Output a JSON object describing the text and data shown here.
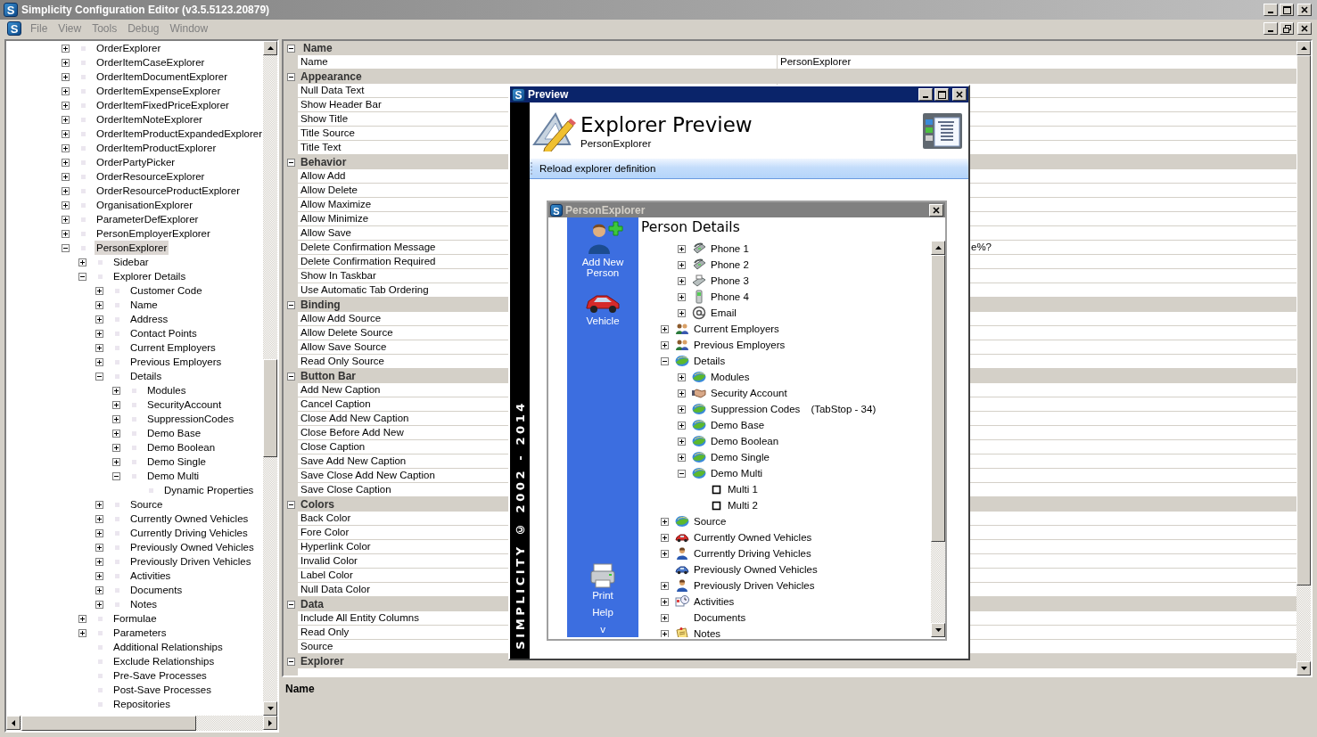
{
  "window": {
    "icon_text": "S",
    "title": "Simplicity Configuration Editor (v3.5.5123.20879)"
  },
  "menu": {
    "icon_text": "S",
    "items": [
      "File",
      "View",
      "Tools",
      "Debug",
      "Window"
    ]
  },
  "left_tree": {
    "items": [
      {
        "label": "OrderExplorer",
        "expanded": false,
        "selected": false
      },
      {
        "label": "OrderItemCaseExplorer",
        "expanded": false,
        "selected": false
      },
      {
        "label": "OrderItemDocumentExplorer",
        "expanded": false,
        "selected": false
      },
      {
        "label": "OrderItemExpenseExplorer",
        "expanded": false,
        "selected": false
      },
      {
        "label": "OrderItemFixedPriceExplorer",
        "expanded": false,
        "selected": false
      },
      {
        "label": "OrderItemNoteExplorer",
        "expanded": false,
        "selected": false
      },
      {
        "label": "OrderItemProductExpandedExplorer",
        "expanded": false,
        "selected": false
      },
      {
        "label": "OrderItemProductExplorer",
        "expanded": false,
        "selected": false
      },
      {
        "label": "OrderPartyPicker",
        "expanded": false,
        "selected": false
      },
      {
        "label": "OrderResourceExplorer",
        "expanded": false,
        "selected": false
      },
      {
        "label": "OrderResourceProductExplorer",
        "expanded": false,
        "selected": false
      },
      {
        "label": "OrganisationExplorer",
        "expanded": false,
        "selected": false
      },
      {
        "label": "ParameterDefExplorer",
        "expanded": false,
        "selected": false
      },
      {
        "label": "PersonEmployerExplorer",
        "expanded": false,
        "selected": false
      },
      {
        "label": "PersonExplorer",
        "expanded": true,
        "selected": true,
        "children": [
          {
            "label": "Sidebar",
            "expanded": false,
            "selected": false
          },
          {
            "label": "Explorer Details",
            "expanded": true,
            "selected": false,
            "children": [
              {
                "label": "Customer Code",
                "expanded": false,
                "selected": false
              },
              {
                "label": "Name",
                "expanded": false,
                "selected": false
              },
              {
                "label": "Address",
                "expanded": false,
                "selected": false
              },
              {
                "label": "Contact Points",
                "expanded": false,
                "selected": false
              },
              {
                "label": "Current Employers",
                "expanded": false,
                "selected": false
              },
              {
                "label": "Previous Employers",
                "expanded": false,
                "selected": false
              },
              {
                "label": "Details",
                "expanded": true,
                "selected": false,
                "children": [
                  {
                    "label": "Modules",
                    "expanded": false,
                    "selected": false
                  },
                  {
                    "label": "SecurityAccount",
                    "expanded": false,
                    "selected": false
                  },
                  {
                    "label": "SuppressionCodes",
                    "expanded": false,
                    "selected": false
                  },
                  {
                    "label": "Demo Base",
                    "expanded": false,
                    "selected": false
                  },
                  {
                    "label": "Demo Boolean",
                    "expanded": false,
                    "selected": false
                  },
                  {
                    "label": "Demo Single",
                    "expanded": false,
                    "selected": false
                  },
                  {
                    "label": "Demo Multi",
                    "expanded": true,
                    "selected": false,
                    "children": [
                      {
                        "label": "Dynamic Properties",
                        "selected": false
                      }
                    ]
                  }
                ]
              },
              {
                "label": "Source",
                "expanded": false,
                "selected": false
              },
              {
                "label": "Currently Owned Vehicles",
                "expanded": false,
                "selected": false
              },
              {
                "label": "Currently Driving Vehicles",
                "expanded": false,
                "selected": false
              },
              {
                "label": "Previously Owned Vehicles",
                "expanded": false,
                "selected": false
              },
              {
                "label": "Previously Driven Vehicles",
                "expanded": false,
                "selected": false
              },
              {
                "label": "Activities",
                "expanded": false,
                "selected": false
              },
              {
                "label": "Documents",
                "expanded": false,
                "selected": false
              },
              {
                "label": "Notes",
                "expanded": false,
                "selected": false
              }
            ]
          },
          {
            "label": "Formulae",
            "expanded": false,
            "selected": false
          },
          {
            "label": "Parameters",
            "expanded": false,
            "selected": false
          },
          {
            "label": "Additional Relationships",
            "selected": false
          },
          {
            "label": "Exclude Relationships",
            "selected": false
          },
          {
            "label": "Pre-Save Processes",
            "selected": false
          },
          {
            "label": "Post-Save Processes",
            "selected": false
          },
          {
            "label": "Repositories",
            "selected": false
          }
        ]
      }
    ]
  },
  "property_grid": {
    "categories": [
      {
        "label": "Name",
        "expanded": true,
        "rows": [
          {
            "label": "Name",
            "value": "PersonExplorer"
          }
        ]
      },
      {
        "label": "Appearance",
        "expanded": true,
        "rows": [
          {
            "label": "Null Data Text"
          },
          {
            "label": "Show Header Bar"
          },
          {
            "label": "Show Title"
          },
          {
            "label": "Title Source"
          },
          {
            "label": "Title Text"
          }
        ]
      },
      {
        "label": "Behavior",
        "expanded": true,
        "rows": [
          {
            "label": "Allow Add"
          },
          {
            "label": "Allow Delete"
          },
          {
            "label": "Allow Maximize"
          },
          {
            "label": "Allow Minimize"
          },
          {
            "label": "Allow Save"
          },
          {
            "label": "Delete Confirmation Message",
            "value": "e%?"
          },
          {
            "label": "Delete Confirmation Required"
          },
          {
            "label": "Show In Taskbar"
          },
          {
            "label": "Use Automatic Tab Ordering"
          }
        ]
      },
      {
        "label": "Binding",
        "expanded": true,
        "rows": [
          {
            "label": "Allow Add Source"
          },
          {
            "label": "Allow Delete Source"
          },
          {
            "label": "Allow Save Source"
          },
          {
            "label": "Read Only Source"
          }
        ]
      },
      {
        "label": "Button Bar",
        "expanded": true,
        "rows": [
          {
            "label": "Add New Caption"
          },
          {
            "label": "Cancel Caption"
          },
          {
            "label": "Close Add New Caption"
          },
          {
            "label": "Close Before Add New"
          },
          {
            "label": "Close Caption"
          },
          {
            "label": "Save Add New Caption"
          },
          {
            "label": "Save Close Add New Caption"
          },
          {
            "label": "Save Close Caption"
          }
        ]
      },
      {
        "label": "Colors",
        "expanded": true,
        "rows": [
          {
            "label": "Back Color"
          },
          {
            "label": "Fore Color"
          },
          {
            "label": "Hyperlink Color"
          },
          {
            "label": "Invalid Color"
          },
          {
            "label": "Label Color"
          },
          {
            "label": "Null Data Color"
          }
        ]
      },
      {
        "label": "Data",
        "expanded": true,
        "rows": [
          {
            "label": "Include All Entity Columns"
          },
          {
            "label": "Read Only"
          },
          {
            "label": "Source"
          }
        ]
      },
      {
        "label": "Explorer",
        "expanded": true
      }
    ]
  },
  "description": {
    "title": "Name"
  },
  "preview": {
    "icon_text": "S",
    "title": "Preview",
    "heading": "Explorer Preview",
    "subtitle": "PersonExplorer",
    "toolbar_button": "Reload explorer definition",
    "side_banner": "SIMPLICITY © 2002 - 2014",
    "explorer": {
      "icon_text": "S",
      "title": "PersonExplorer",
      "sidebar": {
        "top_items": [
          {
            "label": "Add New Person",
            "kind": "add-person"
          },
          {
            "label": "Vehicle",
            "kind": "car"
          }
        ],
        "bottom_items": [
          {
            "label": "Print",
            "kind": "printer"
          },
          {
            "label": "Help",
            "kind": "none"
          },
          {
            "label": "v",
            "kind": "none"
          }
        ]
      },
      "heading": "Person Details",
      "tree": {
        "continued_items": [
          {
            "label": "Phone 1",
            "kind": "phone",
            "expanded": false
          },
          {
            "label": "Phone 2",
            "kind": "phone",
            "expanded": false
          },
          {
            "label": "Phone 3",
            "kind": "fax",
            "expanded": false
          },
          {
            "label": "Phone 4",
            "kind": "mobile",
            "expanded": false
          },
          {
            "label": "Email",
            "kind": "email",
            "expanded": false
          }
        ],
        "items": [
          {
            "label": "Current Employers",
            "kind": "people",
            "expanded": false
          },
          {
            "label": "Previous Employers",
            "kind": "people",
            "expanded": false
          },
          {
            "label": "Details",
            "kind": "globe",
            "expanded": true,
            "children": [
              {
                "label": "Modules",
                "kind": "globe",
                "expanded": false
              },
              {
                "label": "Security Account",
                "kind": "handshake",
                "expanded": false
              },
              {
                "label": "Suppression Codes",
                "note": "(TabStop - 34)",
                "kind": "globe",
                "expanded": false
              },
              {
                "label": "Demo Base",
                "kind": "globe",
                "expanded": false
              },
              {
                "label": "Demo Boolean",
                "kind": "globe",
                "expanded": false
              },
              {
                "label": "Demo Single",
                "kind": "globe",
                "expanded": false
              },
              {
                "label": "Demo Multi",
                "kind": "globe",
                "expanded": true,
                "children": [
                  {
                    "label": "Multi 1",
                    "kind": "checkbox",
                    "checked": false
                  },
                  {
                    "label": "Multi 2",
                    "kind": "checkbox",
                    "checked": false
                  }
                ]
              }
            ]
          },
          {
            "label": "Source",
            "kind": "globe",
            "expanded": false
          },
          {
            "label": "Currently Owned Vehicles",
            "kind": "car",
            "expanded": false
          },
          {
            "label": "Currently Driving Vehicles",
            "kind": "person",
            "expanded": false
          },
          {
            "label": "Previously Owned Vehicles",
            "kind": "car-blue"
          },
          {
            "label": "Previously Driven Vehicles",
            "kind": "person",
            "expanded": false
          },
          {
            "label": "Activities",
            "kind": "activity",
            "expanded": false
          },
          {
            "label": "Documents",
            "kind": "none",
            "expanded": false
          },
          {
            "label": "Notes",
            "kind": "note",
            "expanded": false
          }
        ]
      }
    }
  }
}
